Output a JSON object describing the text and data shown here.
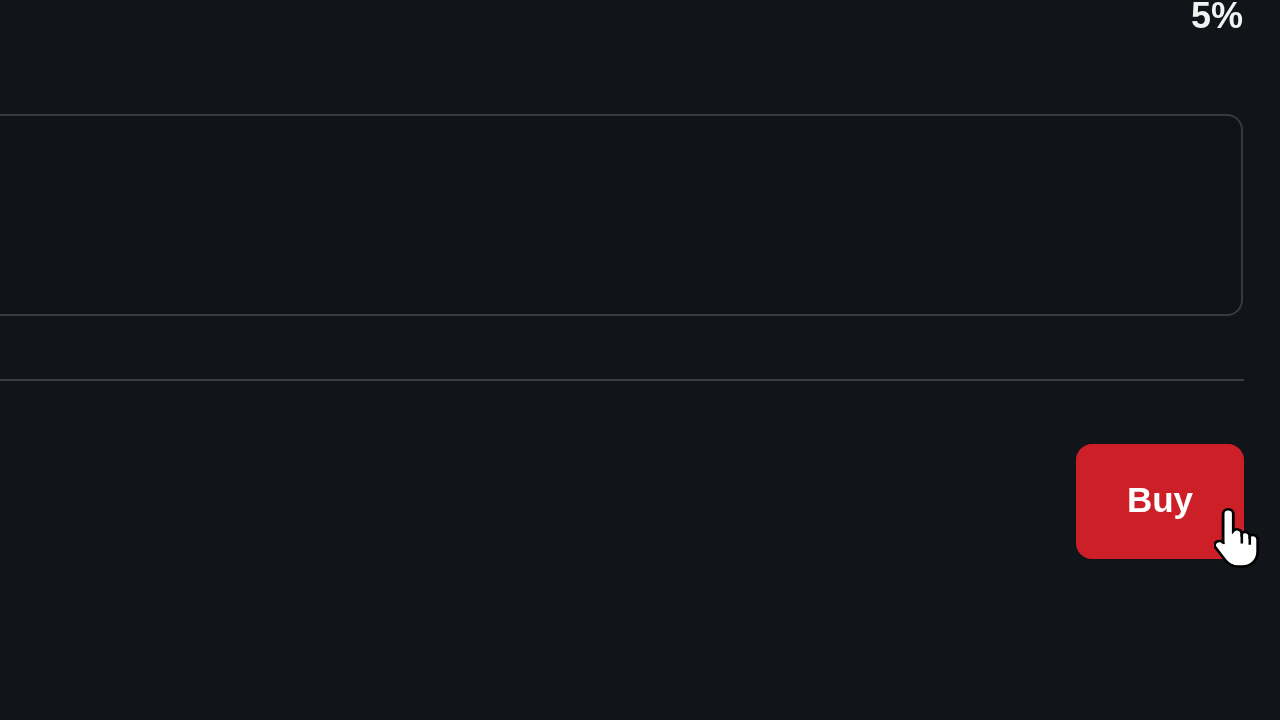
{
  "header": {
    "percent": "5%"
  },
  "buy_button": {
    "label": "Buy"
  }
}
